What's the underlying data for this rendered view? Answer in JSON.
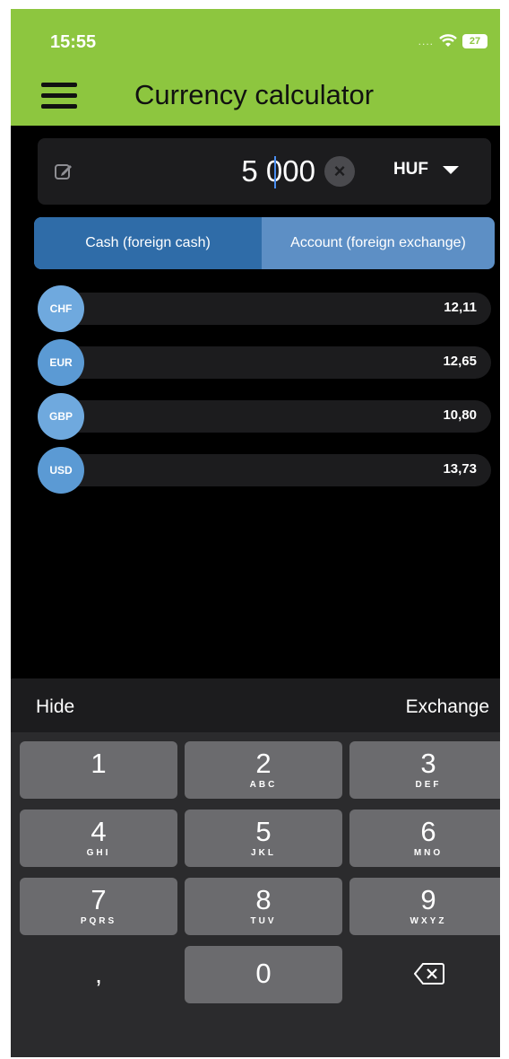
{
  "status_bar": {
    "time": "15:55",
    "signal": "....",
    "battery": "27"
  },
  "header": {
    "title": "Currency calculator",
    "menu_icon": "hamburger-menu-icon"
  },
  "amount": {
    "value": "5 000",
    "currency": "HUF",
    "edit_icon": "pencil-edit-icon",
    "clear_icon": "close-x-icon"
  },
  "mode_tabs": [
    {
      "label": "Cash (foreign cash)",
      "selected": true
    },
    {
      "label": "Account (foreign exchange)",
      "selected": false
    }
  ],
  "rates": [
    {
      "code": "CHF",
      "value": "12,11"
    },
    {
      "code": "EUR",
      "value": "12,65"
    },
    {
      "code": "GBP",
      "value": "10,80"
    },
    {
      "code": "USD",
      "value": "13,73"
    }
  ],
  "keyboard_toolbar": {
    "hide": "Hide",
    "exchange": "Exchange"
  },
  "keypad": {
    "k1": {
      "digit": "1",
      "letters": ""
    },
    "k2": {
      "digit": "2",
      "letters": "ABC"
    },
    "k3": {
      "digit": "3",
      "letters": "DEF"
    },
    "k4": {
      "digit": "4",
      "letters": "GHI"
    },
    "k5": {
      "digit": "5",
      "letters": "JKL"
    },
    "k6": {
      "digit": "6",
      "letters": "MNO"
    },
    "k7": {
      "digit": "7",
      "letters": "PQRS"
    },
    "k8": {
      "digit": "8",
      "letters": "TUV"
    },
    "k9": {
      "digit": "9",
      "letters": "WXYZ"
    },
    "comma": ",",
    "k0": {
      "digit": "0"
    },
    "backspace_icon": "backspace-icon"
  },
  "colors": {
    "header_green": "#8dc63f",
    "selected_tab": "#2f6ca8",
    "tab_bar": "#5d8fc5",
    "badge_blue": "#5b9ad4"
  }
}
